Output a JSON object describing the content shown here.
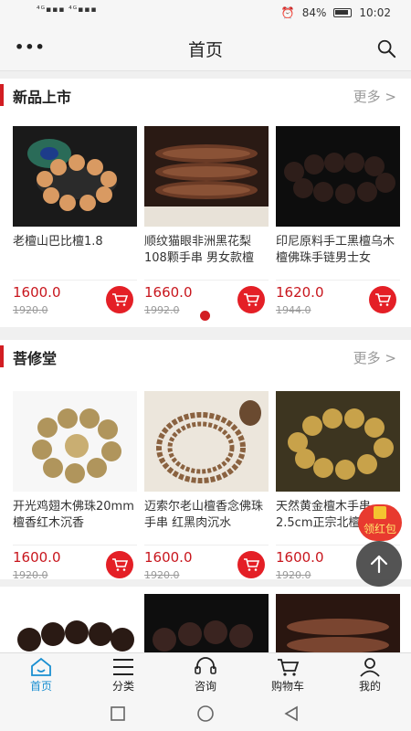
{
  "status": {
    "signal": "⁴ᴳ▪▪▪ ⁴ᴳ▪▪▪",
    "battery": "84%",
    "time": "10:02"
  },
  "header": {
    "title": "首页",
    "menu_icon": "more-dots-icon",
    "search_icon": "search-icon"
  },
  "sections": [
    {
      "name": "新品上市",
      "more": "更多 >",
      "products": [
        {
          "name": "老檀山巴比檀1.8",
          "price": "1600.0",
          "old_price": "1920.0"
        },
        {
          "name": "顺纹猫眼非洲黑花梨108颗手串 男女款檀",
          "price": "1660.0",
          "old_price": "1992.0"
        },
        {
          "name": "印尼原料手工黑檀乌木檀佛珠手链男士女",
          "price": "1620.0",
          "old_price": "1944.0"
        }
      ]
    },
    {
      "name": "菩修堂",
      "more": "更多 >",
      "products": [
        {
          "name": "开光鸡翅木佛珠20mm檀香红木沉香",
          "price": "1600.0",
          "old_price": "1920.0"
        },
        {
          "name": "迈索尔老山檀香念佛珠手串 红黑肉沉水",
          "price": "1600.0",
          "old_price": "1920.0"
        },
        {
          "name": "天然黄金檀木手串2.5cm正宗北檀",
          "price": "1600.0",
          "old_price": "1920.0"
        }
      ]
    }
  ],
  "floating": {
    "redpack_label": "领红包",
    "back_to_top_icon": "arrow-up-icon"
  },
  "tabs": [
    {
      "label": "首页",
      "icon": "home-icon",
      "active": true
    },
    {
      "label": "分类",
      "icon": "list-icon",
      "active": false
    },
    {
      "label": "咨询",
      "icon": "headset-icon",
      "active": false
    },
    {
      "label": "购物车",
      "icon": "cart-icon",
      "active": false
    },
    {
      "label": "我的",
      "icon": "user-icon",
      "active": false
    }
  ],
  "colors": {
    "accent": "#d21d22",
    "tab_active": "#1a8fd1"
  }
}
